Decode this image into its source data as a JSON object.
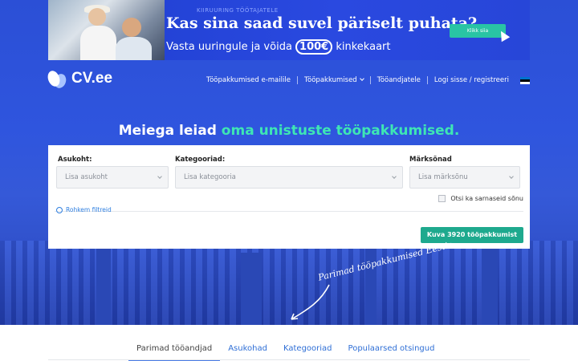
{
  "banner": {
    "eyebrow": "KIIRUURING TÖÖTAJATELE",
    "headline": "Kas sina saad suvel päriselt puhata?",
    "sub_before": "Vasta uuringule ja võida ",
    "sub_pill": "100€",
    "sub_after": " kinkekaart",
    "cta": "Klikk siia"
  },
  "nav": {
    "logo": "CV.ee",
    "items": [
      "Tööpakkumised e-mailile",
      "Tööpakkumised",
      "Tööandjatele",
      "Logi sisse / registreeri"
    ],
    "flag_colors": [
      "#0072ce",
      "#000000",
      "#ffffff"
    ]
  },
  "hero": {
    "title_plain": "Meiega leiad ",
    "title_accent": "oma unistuste tööpakkumised.",
    "accent_color": "#3ee6b4",
    "tagline": "Parimad tööpakkumised Eestis"
  },
  "search": {
    "location_label": "Asukoht:",
    "location_placeholder": "Lisa asukoht",
    "category_label": "Kategooriad:",
    "category_placeholder": "Lisa kategooria",
    "keyword_label": "Märksõnad",
    "keyword_placeholder": "Lisa märksõnu",
    "similar_label": "Otsi ka sarnaseid sõnu",
    "more_filters": "Rohkem filtreid",
    "submit": "Kuva 3920 tööpakkumist"
  },
  "tabs": [
    "Parimad tööandjad",
    "Asukohad",
    "Kategooriad",
    "Populaarsed otsingud"
  ]
}
